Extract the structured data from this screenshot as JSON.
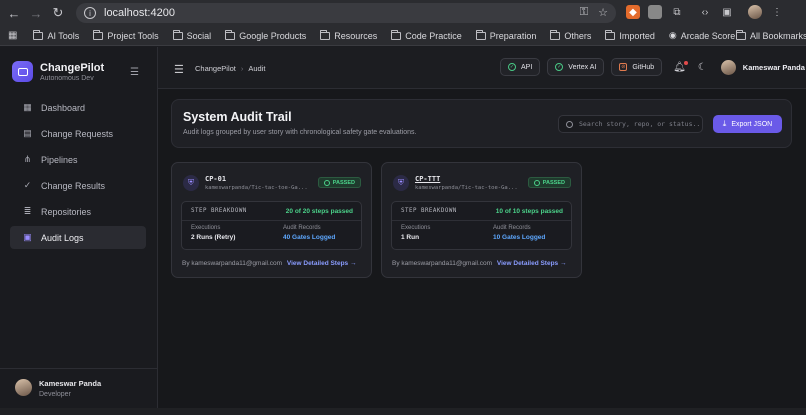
{
  "browser": {
    "url": "localhost:4200",
    "bookmarks": [
      "AI Tools",
      "Project Tools",
      "Social",
      "Google Products",
      "Resources",
      "Code Practice",
      "Preparation",
      "Others",
      "Imported",
      "Arcade Score"
    ],
    "all_bookmarks": "All Bookmarks"
  },
  "sidebar": {
    "brand_title": "ChangePilot",
    "brand_subtitle": "Autonomous Dev",
    "items": [
      {
        "label": "Dashboard",
        "icon": "grid-icon"
      },
      {
        "label": "Change Requests",
        "icon": "document-icon"
      },
      {
        "label": "Pipelines",
        "icon": "pipeline-icon"
      },
      {
        "label": "Change Results",
        "icon": "check-circle-icon"
      },
      {
        "label": "Repositories",
        "icon": "database-icon"
      },
      {
        "label": "Audit Logs",
        "icon": "audit-icon"
      }
    ],
    "active": "Audit Logs",
    "user": {
      "name": "Kameswar Panda",
      "role": "Developer"
    }
  },
  "header": {
    "breadcrumb": [
      "ChangePilot",
      "Audit"
    ],
    "pills": [
      {
        "label": "API",
        "state": "ok"
      },
      {
        "label": "Vertex AI",
        "state": "ok"
      },
      {
        "label": "GitHub",
        "state": "off"
      }
    ],
    "user_name": "Kameswar Panda"
  },
  "page": {
    "title": "System Audit Trail",
    "subtitle": "Audit logs grouped by user story with chronological safety gate evaluations.",
    "search_placeholder": "Search story, repo, or status...",
    "export_label": "Export JSON"
  },
  "cards": [
    {
      "id": "CP-01",
      "repo": "kameswarpanda/Tic-tac-toe-Ga...",
      "status": "PASSED",
      "breakdown_label": "STEP BREAKDOWN",
      "steps": "20 of 20 steps passed",
      "exec_label": "Executions",
      "exec_value": "2 Runs (Retry)",
      "records_label": "Audit Records",
      "records_value": "40 Gates Logged",
      "by": "By kameswarpanda11@gmail.com",
      "link": "View Detailed Steps →"
    },
    {
      "id": "CP-TTT",
      "repo": "kameswarpanda/Tic-tac-toe-Ga...",
      "status": "PASSED",
      "breakdown_label": "STEP BREAKDOWN",
      "steps": "10 of 10 steps passed",
      "exec_label": "Executions",
      "exec_value": "1 Run",
      "records_label": "Audit Records",
      "records_value": "10 Gates Logged",
      "by": "By kameswarpanda11@gmail.com",
      "link": "View Detailed Steps →"
    }
  ],
  "colors": {
    "accent": "#6a5ae8",
    "success": "#4bd38a",
    "link": "#5ea8ff"
  }
}
